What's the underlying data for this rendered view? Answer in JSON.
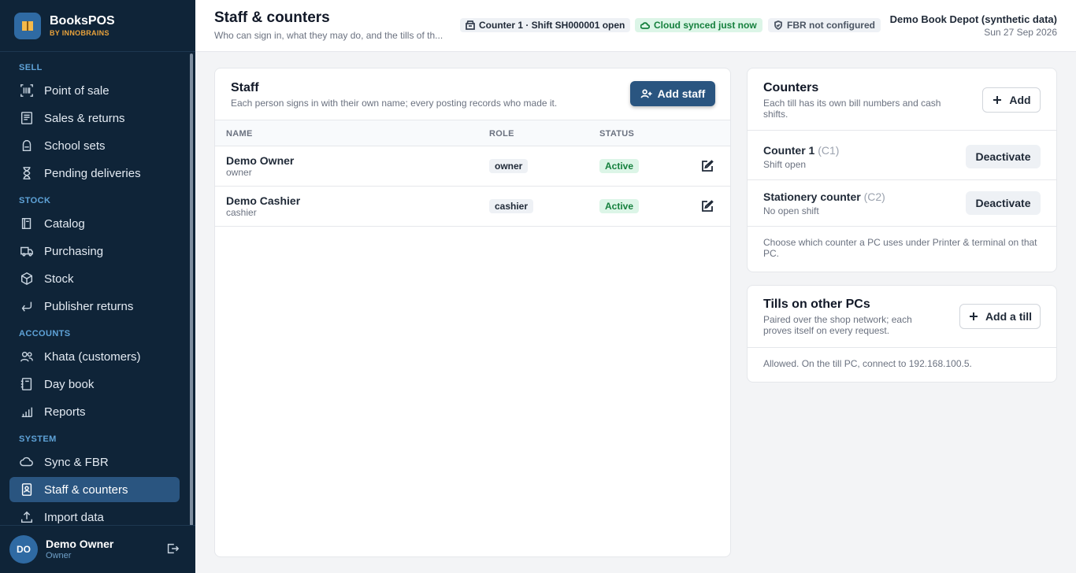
{
  "app": {
    "name": "BooksPOS",
    "byline": "BY INNOBRAINS"
  },
  "nav": {
    "sections": [
      {
        "label": "SELL",
        "items": [
          {
            "label": "Point of sale",
            "icon": "barcode-icon"
          },
          {
            "label": "Sales & returns",
            "icon": "receipt-icon"
          },
          {
            "label": "School sets",
            "icon": "backpack-icon"
          },
          {
            "label": "Pending deliveries",
            "icon": "hourglass-icon"
          }
        ]
      },
      {
        "label": "STOCK",
        "items": [
          {
            "label": "Catalog",
            "icon": "book-icon"
          },
          {
            "label": "Purchasing",
            "icon": "truck-icon"
          },
          {
            "label": "Stock",
            "icon": "box-icon"
          },
          {
            "label": "Publisher returns",
            "icon": "return-arrow-icon"
          }
        ]
      },
      {
        "label": "ACCOUNTS",
        "items": [
          {
            "label": "Khata (customers)",
            "icon": "users-icon"
          },
          {
            "label": "Day book",
            "icon": "notebook-icon"
          },
          {
            "label": "Reports",
            "icon": "bar-chart-icon"
          }
        ]
      },
      {
        "label": "SYSTEM",
        "items": [
          {
            "label": "Sync & FBR",
            "icon": "cloud-icon"
          },
          {
            "label": "Staff & counters",
            "icon": "id-badge-icon",
            "active": true
          },
          {
            "label": "Import data",
            "icon": "upload-icon"
          }
        ]
      }
    ]
  },
  "user": {
    "initials": "DO",
    "name": "Demo Owner",
    "role": "Owner"
  },
  "header": {
    "title": "Staff & counters",
    "subtitle": "Who can sign in, what they may do, and the tills of th...",
    "counter_pill": "Counter 1 · Shift SH000001 open",
    "cloud_pill": "Cloud synced just now",
    "fbr_pill": "FBR not configured",
    "company": "Demo Book Depot (synthetic data)",
    "date": "Sun 27 Sep 2026"
  },
  "staff": {
    "title": "Staff",
    "subtitle": "Each person signs in with their own name; every posting records who made it.",
    "add_label": "Add staff",
    "columns": [
      "NAME",
      "ROLE",
      "STATUS"
    ],
    "rows": [
      {
        "name": "Demo Owner",
        "handle": "owner",
        "role": "owner",
        "status": "Active"
      },
      {
        "name": "Demo Cashier",
        "handle": "cashier",
        "role": "cashier",
        "status": "Active"
      }
    ]
  },
  "counters": {
    "title": "Counters",
    "subtitle": "Each till has its own bill numbers and cash shifts.",
    "add_label": "Add",
    "items": [
      {
        "name": "Counter 1",
        "code": "(C1)",
        "state": "Shift open",
        "action": "Deactivate"
      },
      {
        "name": "Stationery counter",
        "code": "(C2)",
        "state": "No open shift",
        "action": "Deactivate"
      }
    ],
    "note": "Choose which counter a PC uses under Printer & terminal on that PC."
  },
  "tills": {
    "title": "Tills on other PCs",
    "subtitle": "Paired over the shop network; each proves itself on every request.",
    "add_label": "Add a till",
    "note": "Allowed. On the till PC, connect to 192.168.100.5."
  },
  "colors": {
    "sidebar_bg": "#0f2438",
    "accent": "#2a5580",
    "section_label": "#5fa3d8",
    "brand_sub": "#e9a23b",
    "success_bg": "#dcf5e7",
    "success_text": "#15803d"
  }
}
